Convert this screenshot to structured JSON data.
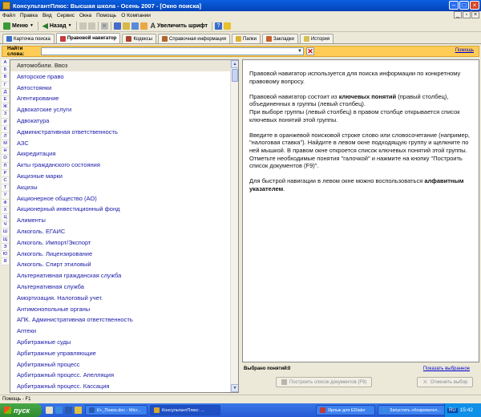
{
  "window": {
    "title": "КонсультантПлюс: Высшая школа - Осень 2007 - [Окно поиска]"
  },
  "menu": [
    "Файл",
    "Правка",
    "Вид",
    "Сервис",
    "Окна",
    "Помощь",
    "О Компании"
  ],
  "toolbar": {
    "menu_label": "Меню",
    "back_label": "Назад",
    "font_label": "Увеличить шрифт"
  },
  "tabs": [
    {
      "label": "Карточка поиска",
      "icon": "search-card-icon"
    },
    {
      "label": "Правовой навигатор",
      "icon": "navigator-icon",
      "active": true
    },
    {
      "label": "Кодексы",
      "icon": "codes-icon"
    },
    {
      "label": "Справочная информация",
      "icon": "reference-icon"
    },
    {
      "label": "Папки",
      "icon": "folder-icon"
    },
    {
      "label": "Закладки",
      "icon": "bookmark-icon"
    },
    {
      "label": "История",
      "icon": "history-icon"
    }
  ],
  "search": {
    "label": "Найти слова:",
    "value": "",
    "help": "Помощь"
  },
  "alphabet": [
    "А",
    "Б",
    "В",
    "Г",
    "Д",
    "Е",
    "Ж",
    "З",
    "И",
    "К",
    "Л",
    "М",
    "Н",
    "О",
    "П",
    "Р",
    "С",
    "Т",
    "У",
    "Ф",
    "Х",
    "Ц",
    "Ч",
    "Ш",
    "Щ",
    "Э",
    "Ю",
    "Я"
  ],
  "groups": [
    "Автомобили. Ввоз",
    "Авторское право",
    "Автостоянки",
    "Агентирование",
    "Адвокатские услуги",
    "Адвокатура",
    "Административная ответственность",
    "АЗС",
    "Аккредитация",
    "Акты гражданского состояния",
    "Акцизные марки",
    "Акцизы",
    "Акционерное общество (АО)",
    "Акционерный инвестиционный фонд",
    "Алименты",
    "Алкоголь. ЕГАИС",
    "Алкоголь. Импорт/Экспорт",
    "Алкоголь. Лицензирование",
    "Алкоголь. Спирт этиловый",
    "Альтернативная гражданская служба",
    "Альтернативная служба",
    "Амортизация. Налоговый учет.",
    "Антимонопольные органы",
    "АПК. Административная ответственность",
    "Аптеки",
    "Арбитражные суды",
    "Арбитражные управляющие",
    "Арбитражный процесс",
    "Арбитражный процесс. Апелляция",
    "Арбитражный процесс. Кассация"
  ],
  "help_text": {
    "p1": "Правовой навигатор используется для поиска информации по конкретному правовому вопросу.",
    "p2_a": "Правовой навигатор состоит из ",
    "p2_b": "ключевых понятий",
    "p2_c": " (правый столбец), объединенных в группы (левый столбец).",
    "p2_d": "При выборе группы (левый столбец) в правом столбце открывается список ключевых понятий этой группы.",
    "p3_a": "Введите в оранжевой поисковой строке слово или словосочетание (например, \"налоговая ставка\"). Найдите в левом окне подходящую группу и щелкните по ней мышкой. В правом окне откроется список ключевых понятий этой группы.",
    "p3_b": "Отметьте необходимые понятия \"галочкой\" и нажмите на кнопку \"Построить список документов (F9)\".",
    "p4_a": "Для быстрой навигации в левом окне можно воспользоваться ",
    "p4_b": "алфавитным указателем",
    "p4_c": "."
  },
  "selection": {
    "label": "Выбрано понятий:",
    "count": "0",
    "show_link": "Показать выбранное",
    "build_button": "Построить список документов (F9)",
    "cancel_button": "Отменить выбор"
  },
  "status": "Помощь - F1",
  "taskbar": {
    "start": "пуск",
    "tasks": [
      {
        "label": "К+_Поиск.doc - Micr...",
        "active": false
      },
      {
        "label": "КонсультантПлюс: ...",
        "active": true
      },
      {
        "label": "Ярлык для EDialer",
        "active": false
      },
      {
        "label": "Запустить обозревател...",
        "active": false
      }
    ],
    "lang": "RU",
    "clock": "15:42"
  }
}
